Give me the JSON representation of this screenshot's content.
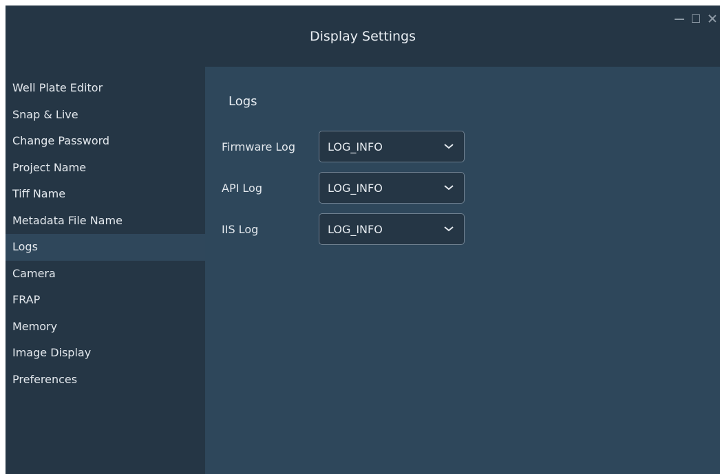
{
  "window": {
    "title": "Display Settings"
  },
  "sidebar": {
    "items": [
      {
        "label": "Well Plate Editor"
      },
      {
        "label": "Snap & Live"
      },
      {
        "label": "Change Password"
      },
      {
        "label": "Project Name"
      },
      {
        "label": "Tiff Name"
      },
      {
        "label": "Metadata File Name"
      },
      {
        "label": "Logs"
      },
      {
        "label": "Camera"
      },
      {
        "label": "FRAP"
      },
      {
        "label": "Memory"
      },
      {
        "label": "Image Display"
      },
      {
        "label": "Preferences"
      }
    ],
    "selected": "Logs"
  },
  "main": {
    "section_title": "Logs",
    "rows": [
      {
        "label": "Firmware Log",
        "value": "LOG_INFO"
      },
      {
        "label": "API Log",
        "value": "LOG_INFO"
      },
      {
        "label": "IIS Log",
        "value": "LOG_INFO"
      }
    ]
  },
  "colors": {
    "window_bg": "#253645",
    "panel_bg": "#2e475b",
    "selected_bg": "#2f475b",
    "text": "#e3e8ed"
  },
  "icons": {
    "minimize": "minimize-icon",
    "maximize": "maximize-icon",
    "close": "close-icon",
    "dropdown": "chevron-down-icon"
  }
}
